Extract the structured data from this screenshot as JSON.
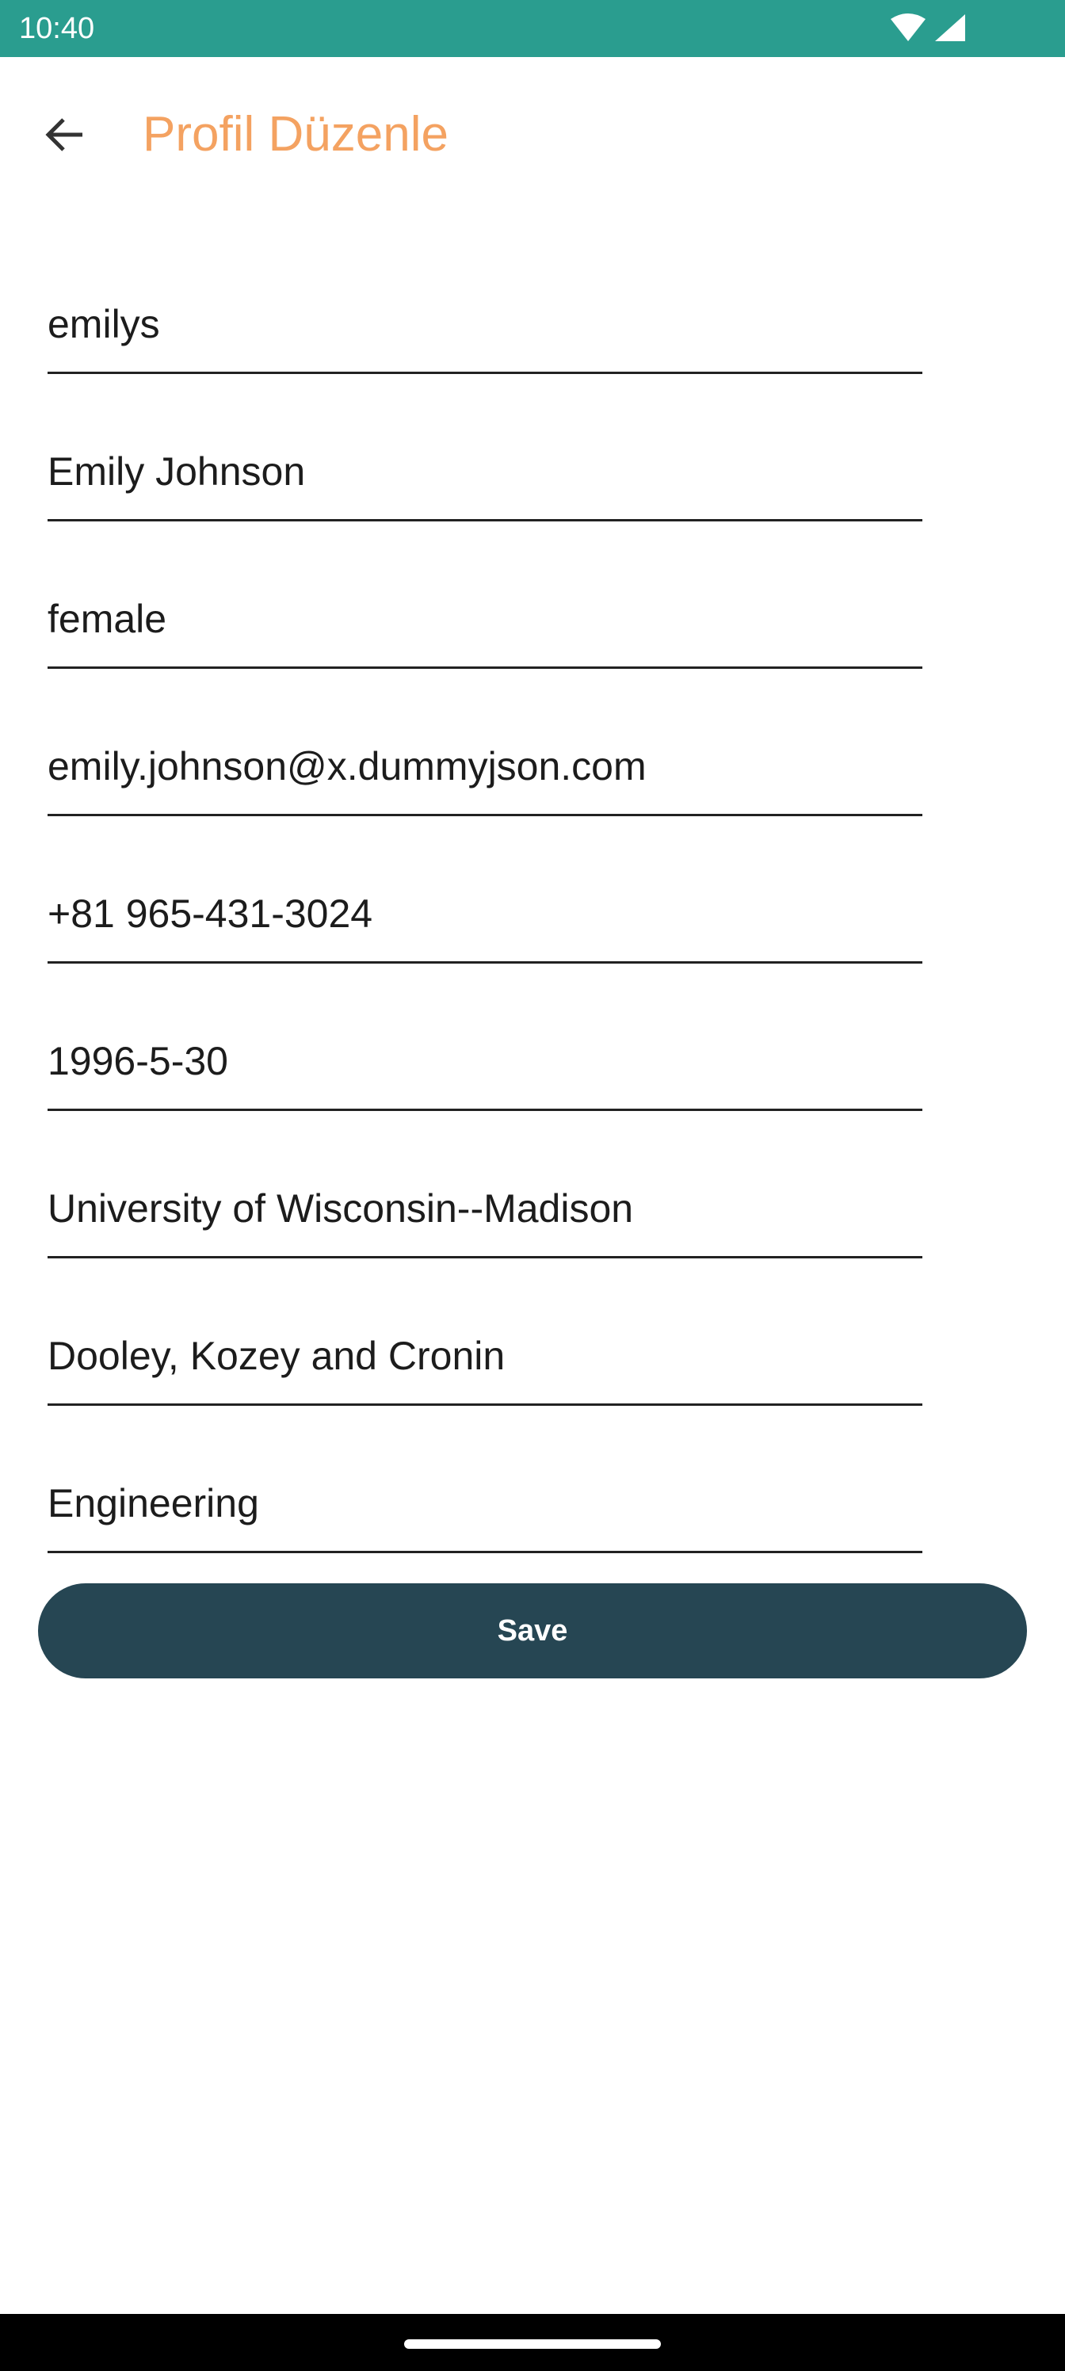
{
  "status_bar": {
    "time": "10:40",
    "icons": [
      "wifi-icon",
      "signal-icon"
    ],
    "background": "#2a9d8f"
  },
  "app_bar": {
    "title": "Profil Düzenle",
    "back_icon": "arrow-left-icon",
    "title_color": "#f4a261"
  },
  "form": {
    "fields": [
      {
        "name": "username",
        "value": "emilys"
      },
      {
        "name": "full_name",
        "value": "Emily Johnson"
      },
      {
        "name": "gender",
        "value": "female"
      },
      {
        "name": "email",
        "value": "emily.johnson@x.dummyjson.com"
      },
      {
        "name": "phone",
        "value": "+81 965-431-3024"
      },
      {
        "name": "birth_date",
        "value": "1996-5-30"
      },
      {
        "name": "university",
        "value": "University of Wisconsin--Madison"
      },
      {
        "name": "company",
        "value": "Dooley, Kozey and Cronin"
      },
      {
        "name": "department",
        "value": "Engineering"
      }
    ],
    "save_label": "Save",
    "save_color": "#264653"
  }
}
